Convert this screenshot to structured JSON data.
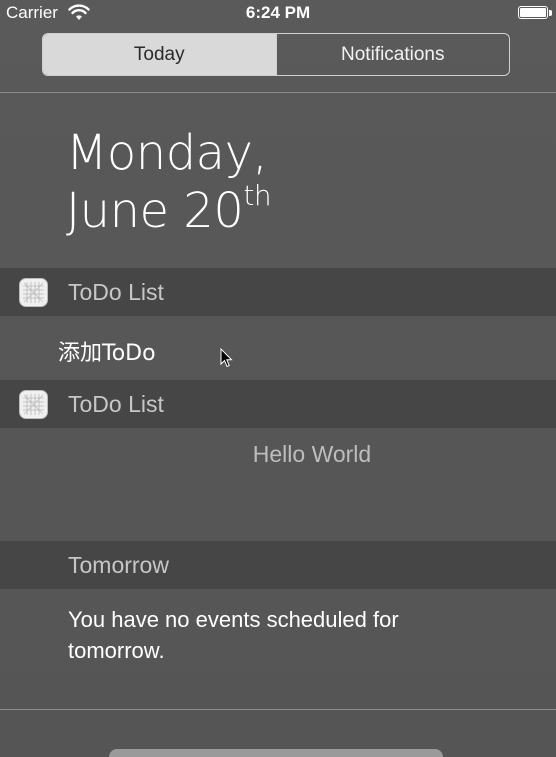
{
  "status_bar": {
    "carrier": "Carrier",
    "time": "6:24 PM",
    "wifi_icon": "wifi-icon",
    "battery_icon": "battery-icon"
  },
  "segmented_control": {
    "tabs": [
      {
        "label": "Today",
        "selected": true
      },
      {
        "label": "Notifications",
        "selected": false
      }
    ]
  },
  "date_header": {
    "weekday": "Monday,",
    "month_day": "June 20",
    "suffix": "th"
  },
  "widgets": [
    {
      "icon": "todo-app-icon",
      "title": "ToDo List",
      "content": "添加ToDo"
    },
    {
      "icon": "todo-app-icon",
      "title": "ToDo List",
      "content": "Hello World"
    }
  ],
  "tomorrow": {
    "title": "Tomorrow",
    "message": "You have no events scheduled for tomorrow."
  },
  "colors": {
    "background": "#565656",
    "header_band": "#464646",
    "selected_segment": "#d9d9d9",
    "muted_text": "#c7c7c7"
  }
}
